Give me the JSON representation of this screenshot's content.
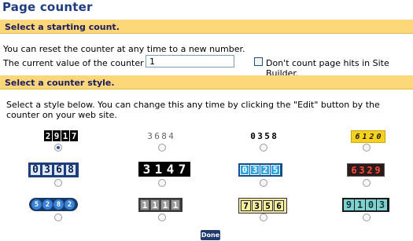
{
  "page_title": "Page counter",
  "section1": {
    "header": "Select a starting count.",
    "reset_text": "You can reset the counter at any time to a new number.",
    "current_label": "The current value of the counter is:",
    "current_value": "1",
    "checkbox_label": "Don't count page hits in Site Builder.",
    "checkbox_checked": false
  },
  "section2": {
    "header": "Select a counter style.",
    "description": "Select a style below. You can change this any time by clicking the \"Edit\" button by the counter on your web site."
  },
  "styles": [
    {
      "digits": "2917",
      "selected": true
    },
    {
      "digits": "3684",
      "selected": false
    },
    {
      "digits": "0358",
      "selected": false
    },
    {
      "digits": "6120",
      "selected": false
    },
    {
      "digits": "0368",
      "selected": false
    },
    {
      "digits": "3147",
      "selected": false
    },
    {
      "digits": "0325",
      "selected": false
    },
    {
      "digits": "6329",
      "selected": false
    },
    {
      "digits": "5282",
      "selected": false
    },
    {
      "digits": "1111",
      "selected": false
    },
    {
      "digits": "7356",
      "selected": false
    },
    {
      "digits": "9103",
      "selected": false
    }
  ],
  "done_label": "Done"
}
